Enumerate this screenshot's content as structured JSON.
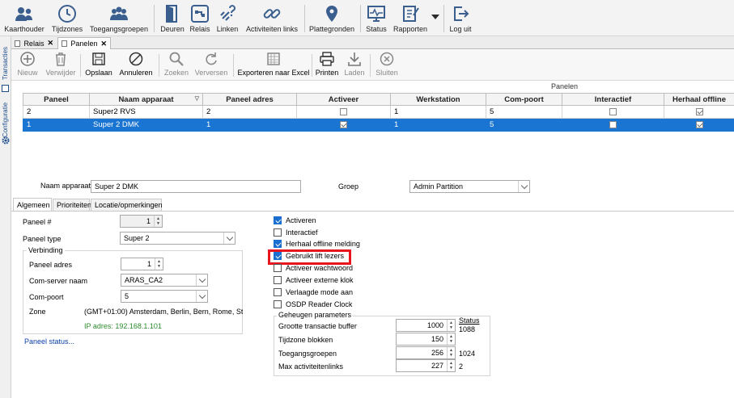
{
  "ribbon": {
    "items": [
      {
        "label": "Kaarthouder",
        "icon": "people-icon"
      },
      {
        "label": "Tijdzones",
        "icon": "clock-icon"
      },
      {
        "label": "Toegangsgroepen",
        "icon": "group-icon"
      },
      {
        "label": "Deuren",
        "icon": "door-icon"
      },
      {
        "label": "Relais",
        "icon": "relay-icon"
      },
      {
        "label": "Linken",
        "icon": "link-question-icon"
      },
      {
        "label": "Activiteiten links",
        "icon": "chain-link-icon"
      },
      {
        "label": "Plattegronden",
        "icon": "map-pin-icon"
      },
      {
        "label": "Status",
        "icon": "monitor-icon"
      },
      {
        "label": "Rapporten",
        "icon": "report-icon"
      },
      {
        "label": "Log uit",
        "icon": "logout-icon"
      }
    ]
  },
  "sidebar": {
    "tabs": [
      "Transacties",
      "Configuratie"
    ]
  },
  "doc_tabs": [
    {
      "label": "Relais"
    },
    {
      "label": "Panelen"
    }
  ],
  "toolbar": {
    "items": [
      {
        "label": "Nieuw",
        "icon": "plus-icon"
      },
      {
        "label": "Verwijder",
        "icon": "trash-icon"
      },
      {
        "label": "Opslaan",
        "icon": "save-icon"
      },
      {
        "label": "Annuleren",
        "icon": "cancel-icon"
      },
      {
        "label": "Zoeken",
        "icon": "search-icon"
      },
      {
        "label": "Verversen",
        "icon": "refresh-icon"
      },
      {
        "label": "Exporteren naar Excel",
        "icon": "excel-icon"
      },
      {
        "label": "Printen",
        "icon": "printer-icon"
      },
      {
        "label": "Laden",
        "icon": "download-icon"
      },
      {
        "label": "Sluiten",
        "icon": "close-circle-icon"
      }
    ]
  },
  "grid": {
    "caption": "Panelen",
    "columns": [
      "Paneel",
      "Naam apparaat",
      "Paneel adres",
      "Activeer",
      "Werkstation",
      "Com-poort",
      "Interactief",
      "Herhaal offline"
    ],
    "rows": [
      {
        "paneel": "2",
        "naam": "Super2 RVS",
        "adres": "2",
        "activeer": false,
        "werkstation": "1",
        "com": "5",
        "interactief": false,
        "herhaal": true,
        "selected": false
      },
      {
        "paneel": "1",
        "naam": "Super 2 DMK",
        "adres": "1",
        "activeer": true,
        "werkstation": "1",
        "com": "5",
        "interactief": false,
        "herhaal": true,
        "selected": true
      }
    ]
  },
  "detail": {
    "naam_label": "Naam apparaat",
    "naam_value": "Super 2 DMK",
    "groep_label": "Groep",
    "groep_value": "Admin Partition",
    "tabs": [
      "Algemeen",
      "Prioriteiten",
      "Locatie/opmerkingen"
    ],
    "paneel_nr_label": "Paneel #",
    "paneel_nr_value": "1",
    "paneel_type_label": "Paneel type",
    "paneel_type_value": "Super 2",
    "verbinding_title": "Verbinding",
    "paneel_adres_label": "Paneel adres",
    "paneel_adres_value": "1",
    "com_server_label": "Com-server naam",
    "com_server_value": "ARAS_CA2",
    "com_poort_label": "Com-poort",
    "com_poort_value": "5",
    "zone_label": "Zone",
    "zone_value": "(GMT+01:00) Amsterdam, Berlin, Bern, Rome, Stockh",
    "ip_text": "IP adres: 192.168.1.101",
    "paneel_status_link": "Paneel status...",
    "checkboxes": [
      {
        "label": "Activeren",
        "checked": true
      },
      {
        "label": "Interactief",
        "checked": false
      },
      {
        "label": "Herhaal offline melding",
        "checked": true
      },
      {
        "label": "Gebruikt lift lezers",
        "checked": true
      },
      {
        "label": "Activeer wachtwoord",
        "checked": false
      },
      {
        "label": "Activeer externe klok",
        "checked": false
      },
      {
        "label": "Verlaagde mode aan",
        "checked": false
      },
      {
        "label": "OSDP Reader Clock",
        "checked": false
      }
    ],
    "geheugen": {
      "title": "Geheugen parameters",
      "status_header": "Status",
      "rows": [
        {
          "label": "Grootte transactie buffer",
          "value": "1000",
          "status": "1088"
        },
        {
          "label": "Tijdzone blokken",
          "value": "150",
          "status": ""
        },
        {
          "label": "Toegangsgroepen",
          "value": "256",
          "status": "1024"
        },
        {
          "label": "Max activiteitenlinks",
          "value": "227",
          "status": "2"
        }
      ]
    }
  },
  "colors": {
    "accent": "#1a74d1",
    "highlight": "#e8141e",
    "ip_text": "#2e8b2e"
  }
}
